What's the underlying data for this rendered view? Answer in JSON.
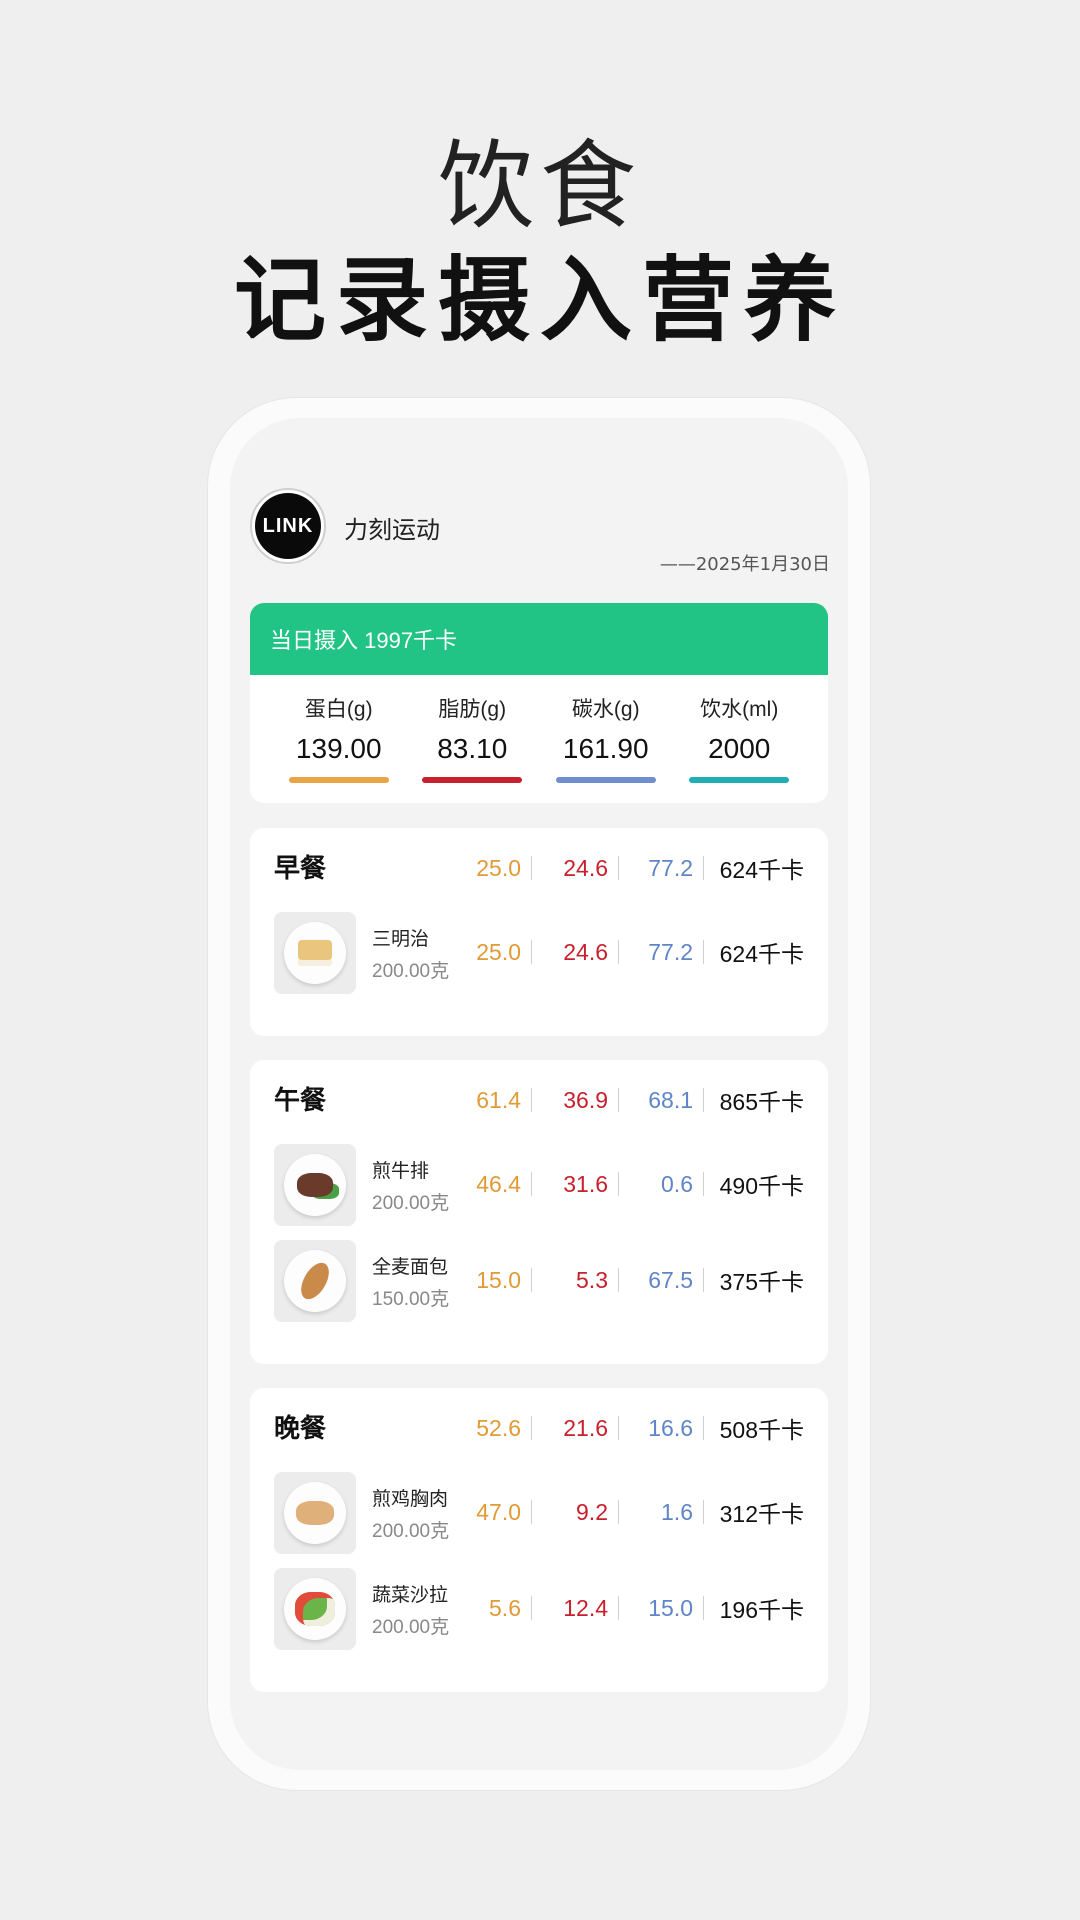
{
  "hero": {
    "subtitle": "饮食",
    "title": "记录摄入营养"
  },
  "app": {
    "logo_text": "LINK",
    "name": "力刻运动",
    "date": "——2025年1月30日"
  },
  "summary": {
    "intake_text": "当日摄入 1997千卡",
    "macros": [
      {
        "label": "蛋白(g)",
        "value": "139.00",
        "color": "#e8a445"
      },
      {
        "label": "脂肪(g)",
        "value": "83.10",
        "color": "#c8202c"
      },
      {
        "label": "碳水(g)",
        "value": "161.90",
        "color": "#6f8fd2"
      },
      {
        "label": "饮水(ml)",
        "value": "2000",
        "color": "#1faeb2"
      }
    ]
  },
  "meals": [
    {
      "title": "早餐",
      "totals": {
        "protein": "25.0",
        "fat": "24.6",
        "carbs": "77.2",
        "kcal": "624千卡"
      },
      "items": [
        {
          "name": "三明治",
          "qty": "200.00克",
          "protein": "25.0",
          "fat": "24.6",
          "carbs": "77.2",
          "kcal": "624千卡",
          "icon": "sandwich-icon"
        }
      ]
    },
    {
      "title": "午餐",
      "totals": {
        "protein": "61.4",
        "fat": "36.9",
        "carbs": "68.1",
        "kcal": "865千卡"
      },
      "items": [
        {
          "name": "煎牛排",
          "qty": "200.00克",
          "protein": "46.4",
          "fat": "31.6",
          "carbs": "0.6",
          "kcal": "490千卡",
          "icon": "steak-icon"
        },
        {
          "name": "全麦面包",
          "qty": "150.00克",
          "protein": "15.0",
          "fat": "5.3",
          "carbs": "67.5",
          "kcal": "375千卡",
          "icon": "bread-icon"
        }
      ]
    },
    {
      "title": "晚餐",
      "totals": {
        "protein": "52.6",
        "fat": "21.6",
        "carbs": "16.6",
        "kcal": "508千卡"
      },
      "items": [
        {
          "name": "煎鸡胸肉",
          "qty": "200.00克",
          "protein": "47.0",
          "fat": "9.2",
          "carbs": "1.6",
          "kcal": "312千卡",
          "icon": "chicken-breast-icon"
        },
        {
          "name": "蔬菜沙拉",
          "qty": "200.00克",
          "protein": "5.6",
          "fat": "12.4",
          "carbs": "15.0",
          "kcal": "196千卡",
          "icon": "salad-icon"
        }
      ]
    }
  ]
}
